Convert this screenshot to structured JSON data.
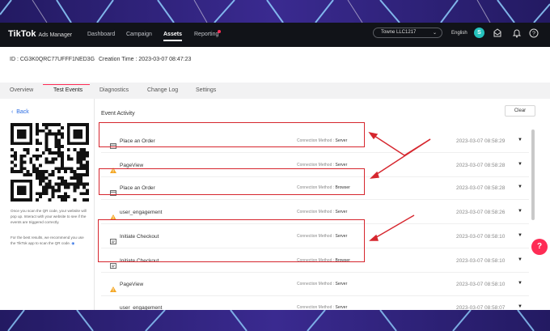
{
  "app": {
    "logo": "TikTok",
    "product": "Ads Manager"
  },
  "nav": {
    "items": [
      "Dashboard",
      "Campaign",
      "Assets",
      "Reporting"
    ],
    "active": "Assets"
  },
  "account": {
    "name": "Towne LLC1217",
    "language": "English",
    "avatar_initial": "S"
  },
  "pixel": {
    "id_text": "ID : CG3K0QRC77UFFF1NED3G",
    "creation_text": "Creation Time : 2023-03-07 08:47:23"
  },
  "tabs": [
    "Overview",
    "Test Events",
    "Diagnostics",
    "Change Log",
    "Settings"
  ],
  "active_tab": "Test Events",
  "left": {
    "back_label": "Back",
    "note1": "Once you scan the QR code, your website will pop up. Interact with your website to see if the events are triggered correctly.",
    "note2": "For the best results, we recommend you use the TikTok app to scan the QR code."
  },
  "activity": {
    "title": "Event Activity",
    "clear_label": "Clear",
    "method_label": "Connection Method :",
    "rows": [
      {
        "event": "Place an Order",
        "method": "Server",
        "time": "2023-03-07 08:58:29",
        "icon": "order-icon"
      },
      {
        "event": "PageView",
        "method": "Server",
        "time": "2023-03-07 08:58:28",
        "icon": "warning-icon"
      },
      {
        "event": "Place an Order",
        "method": "Browser",
        "time": "2023-03-07 08:58:28",
        "icon": "order-icon"
      },
      {
        "event": "user_engagement",
        "method": "Server",
        "time": "2023-03-07 08:58:26",
        "icon": "warning-icon"
      },
      {
        "event": "Initiate Checkout",
        "method": "Server",
        "time": "2023-03-07 08:58:10",
        "icon": "checkout-icon"
      },
      {
        "event": "Initiate Checkout",
        "method": "Browser",
        "time": "2023-03-07 08:58:10",
        "icon": "checkout-icon"
      },
      {
        "event": "PageView",
        "method": "Server",
        "time": "2023-03-07 08:58:10",
        "icon": "warning-icon"
      },
      {
        "event": "user_engagement",
        "method": "Server",
        "time": "2023-03-07 08:58:07",
        "icon": "warning-icon"
      }
    ]
  },
  "colors": {
    "accent": "#fe2c55",
    "annotation": "#d6262e",
    "topbar": "#111318",
    "link": "#2b6de3"
  }
}
